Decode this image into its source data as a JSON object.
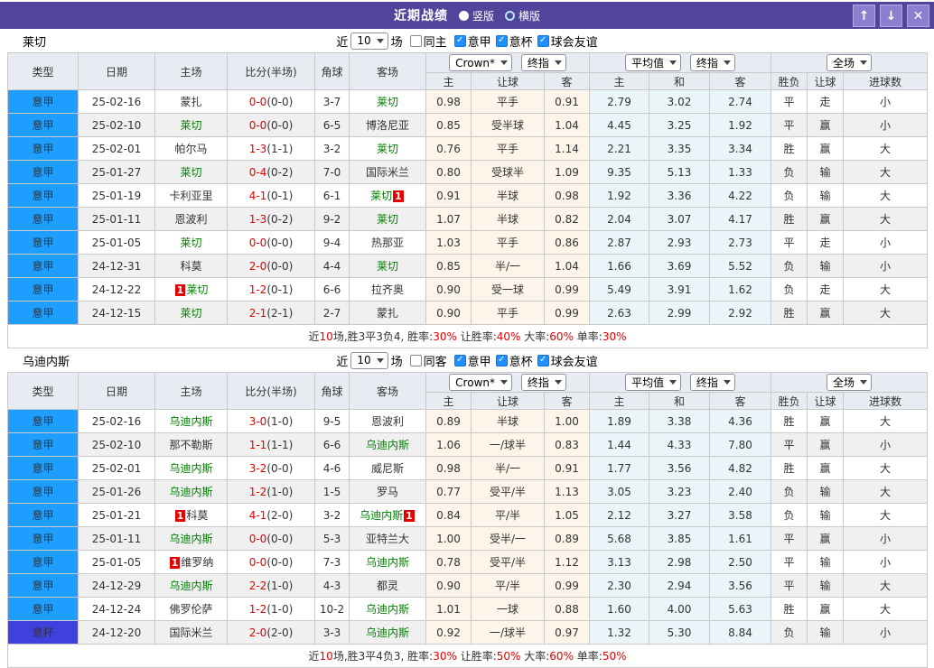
{
  "titlebar": {
    "title": "近期战绩",
    "radios": [
      {
        "label": "竖版",
        "selected": true
      },
      {
        "label": "横版",
        "selected": false
      }
    ],
    "buttons": {
      "up": "↑",
      "down": "↓",
      "close": "✕"
    }
  },
  "icons": {
    "check_mark": "✓"
  },
  "accent_colors": {
    "titlebar": "#50459b",
    "league_serie_a": "#1e9fff",
    "league_cup": "#4040dd",
    "win_red": "#e60000",
    "draw_green": "#008000",
    "lose_blue": "#2b2bd5",
    "odds_column_bg": "#fdf5ea",
    "average_column_bg": "#eaf5fa"
  },
  "filter_shared": {
    "near": "近",
    "games": "场"
  },
  "header": {
    "static_cols": [
      "类型",
      "日期",
      "主场",
      "比分(半场)",
      "角球",
      "客场"
    ],
    "odds_selects": [
      "Crown*",
      "终指"
    ],
    "odds_sub": [
      "主",
      "让球",
      "客"
    ],
    "avg_selects": [
      "平均值",
      "终指"
    ],
    "avg_sub": [
      "主",
      "和",
      "客"
    ],
    "result_select": "全场",
    "result_sub": [
      "胜负",
      "让球",
      "进球数"
    ]
  },
  "sections": [
    {
      "team": "莱切",
      "filter": {
        "count": "10",
        "same_label": "同主",
        "same_checked": false,
        "checks": [
          {
            "label": "意甲",
            "checked": true
          },
          {
            "label": "意杯",
            "checked": true
          },
          {
            "label": "球会友谊",
            "checked": true
          }
        ]
      },
      "rows": [
        {
          "league": "意甲",
          "date": "25-02-16",
          "home": "蒙扎",
          "home_green": false,
          "ft": "0-0",
          "ht": "(0-0)",
          "corner": "3-7",
          "away": "莱切",
          "away_green": true,
          "odds": [
            "0.98",
            "平手",
            "0.91"
          ],
          "avg": [
            "2.79",
            "3.02",
            "2.74"
          ],
          "results": [
            "平",
            "走",
            "小"
          ]
        },
        {
          "league": "意甲",
          "date": "25-02-10",
          "home": "莱切",
          "home_green": true,
          "ft": "0-0",
          "ht": "(0-0)",
          "corner": "6-5",
          "away": "博洛尼亚",
          "away_green": false,
          "odds": [
            "0.85",
            "受半球",
            "1.04"
          ],
          "avg": [
            "4.45",
            "3.25",
            "1.92"
          ],
          "results": [
            "平",
            "赢",
            "小"
          ]
        },
        {
          "league": "意甲",
          "date": "25-02-01",
          "home": "帕尔马",
          "home_green": false,
          "ft": "1-3",
          "ht": "(1-1)",
          "corner": "3-2",
          "away": "莱切",
          "away_green": true,
          "odds": [
            "0.76",
            "平手",
            "1.14"
          ],
          "avg": [
            "2.21",
            "3.35",
            "3.34"
          ],
          "results": [
            "胜",
            "赢",
            "大"
          ]
        },
        {
          "league": "意甲",
          "date": "25-01-27",
          "home": "莱切",
          "home_green": true,
          "ft": "0-4",
          "ht": "(0-2)",
          "corner": "7-0",
          "away": "国际米兰",
          "away_green": false,
          "odds": [
            "0.80",
            "受球半",
            "1.09"
          ],
          "avg": [
            "9.35",
            "5.13",
            "1.33"
          ],
          "results": [
            "负",
            "输",
            "大"
          ]
        },
        {
          "league": "意甲",
          "date": "25-01-19",
          "home": "卡利亚里",
          "home_green": false,
          "ft": "4-1",
          "ht": "(0-1)",
          "corner": "6-1",
          "away": "莱切",
          "away_green": true,
          "away_badge": "1",
          "odds": [
            "0.91",
            "半球",
            "0.98"
          ],
          "avg": [
            "1.92",
            "3.36",
            "4.22"
          ],
          "results": [
            "负",
            "输",
            "大"
          ]
        },
        {
          "league": "意甲",
          "date": "25-01-11",
          "home": "恩波利",
          "home_green": false,
          "ft": "1-3",
          "ht": "(0-2)",
          "corner": "9-2",
          "away": "莱切",
          "away_green": true,
          "odds": [
            "1.07",
            "半球",
            "0.82"
          ],
          "avg": [
            "2.04",
            "3.07",
            "4.17"
          ],
          "results": [
            "胜",
            "赢",
            "大"
          ]
        },
        {
          "league": "意甲",
          "date": "25-01-05",
          "home": "莱切",
          "home_green": true,
          "ft": "0-0",
          "ht": "(0-0)",
          "corner": "9-4",
          "away": "热那亚",
          "away_green": false,
          "odds": [
            "1.03",
            "平手",
            "0.86"
          ],
          "avg": [
            "2.87",
            "2.93",
            "2.73"
          ],
          "results": [
            "平",
            "走",
            "小"
          ]
        },
        {
          "league": "意甲",
          "date": "24-12-31",
          "home": "科莫",
          "home_green": false,
          "ft": "2-0",
          "ht": "(0-0)",
          "corner": "4-4",
          "away": "莱切",
          "away_green": true,
          "odds": [
            "0.85",
            "半/一",
            "1.04"
          ],
          "avg": [
            "1.66",
            "3.69",
            "5.52"
          ],
          "results": [
            "负",
            "输",
            "小"
          ]
        },
        {
          "league": "意甲",
          "date": "24-12-22",
          "home": "莱切",
          "home_green": true,
          "home_badge": "1",
          "ft": "1-2",
          "ht": "(0-1)",
          "corner": "6-6",
          "away": "拉齐奥",
          "away_green": false,
          "odds": [
            "0.90",
            "受一球",
            "0.99"
          ],
          "avg": [
            "5.49",
            "3.91",
            "1.62"
          ],
          "results": [
            "负",
            "走",
            "大"
          ]
        },
        {
          "league": "意甲",
          "date": "24-12-15",
          "home": "莱切",
          "home_green": true,
          "ft": "2-1",
          "ht": "(2-1)",
          "corner": "2-7",
          "away": "蒙扎",
          "away_green": false,
          "odds": [
            "0.90",
            "平手",
            "0.99"
          ],
          "avg": [
            "2.63",
            "2.99",
            "2.92"
          ],
          "results": [
            "胜",
            "赢",
            "大"
          ]
        }
      ],
      "summary_parts": [
        {
          "t": "近"
        },
        {
          "t": "10",
          "red": true
        },
        {
          "t": "场,胜3平3负4, 胜率:"
        },
        {
          "t": "30%",
          "red": true
        },
        {
          "t": " 让胜率:"
        },
        {
          "t": "40%",
          "red": true
        },
        {
          "t": " 大率:"
        },
        {
          "t": "60%",
          "red": true
        },
        {
          "t": " 单率:"
        },
        {
          "t": "30%",
          "red": true
        }
      ]
    },
    {
      "team": "乌迪内斯",
      "filter": {
        "count": "10",
        "same_label": "同客",
        "same_checked": false,
        "checks": [
          {
            "label": "意甲",
            "checked": true
          },
          {
            "label": "意杯",
            "checked": true
          },
          {
            "label": "球会友谊",
            "checked": true
          }
        ]
      },
      "rows": [
        {
          "league": "意甲",
          "date": "25-02-16",
          "home": "乌迪内斯",
          "home_green": true,
          "ft": "3-0",
          "ht": "(1-0)",
          "corner": "9-5",
          "away": "恩波利",
          "away_green": false,
          "odds": [
            "0.89",
            "半球",
            "1.00"
          ],
          "avg": [
            "1.89",
            "3.38",
            "4.36"
          ],
          "results": [
            "胜",
            "赢",
            "大"
          ]
        },
        {
          "league": "意甲",
          "date": "25-02-10",
          "home": "那不勒斯",
          "home_green": false,
          "ft": "1-1",
          "ht": "(1-1)",
          "corner": "6-6",
          "away": "乌迪内斯",
          "away_green": true,
          "odds": [
            "1.06",
            "一/球半",
            "0.83"
          ],
          "avg": [
            "1.44",
            "4.33",
            "7.80"
          ],
          "results": [
            "平",
            "赢",
            "小"
          ]
        },
        {
          "league": "意甲",
          "date": "25-02-01",
          "home": "乌迪内斯",
          "home_green": true,
          "ft": "3-2",
          "ht": "(0-0)",
          "corner": "4-6",
          "away": "威尼斯",
          "away_green": false,
          "odds": [
            "0.98",
            "半/一",
            "0.91"
          ],
          "avg": [
            "1.77",
            "3.56",
            "4.82"
          ],
          "results": [
            "胜",
            "赢",
            "大"
          ]
        },
        {
          "league": "意甲",
          "date": "25-01-26",
          "home": "乌迪内斯",
          "home_green": true,
          "ft": "1-2",
          "ht": "(1-0)",
          "corner": "1-5",
          "away": "罗马",
          "away_green": false,
          "odds": [
            "0.77",
            "受平/半",
            "1.13"
          ],
          "avg": [
            "3.05",
            "3.23",
            "2.40"
          ],
          "results": [
            "负",
            "输",
            "大"
          ]
        },
        {
          "league": "意甲",
          "date": "25-01-21",
          "home": "科莫",
          "home_green": false,
          "home_badge": "1",
          "ft": "4-1",
          "ht": "(2-0)",
          "corner": "3-2",
          "away": "乌迪内斯",
          "away_green": true,
          "away_badge": "1",
          "odds": [
            "0.84",
            "平/半",
            "1.05"
          ],
          "avg": [
            "2.12",
            "3.27",
            "3.58"
          ],
          "results": [
            "负",
            "输",
            "大"
          ]
        },
        {
          "league": "意甲",
          "date": "25-01-11",
          "home": "乌迪内斯",
          "home_green": true,
          "ft": "0-0",
          "ht": "(0-0)",
          "corner": "5-3",
          "away": "亚特兰大",
          "away_green": false,
          "odds": [
            "1.00",
            "受半/一",
            "0.89"
          ],
          "avg": [
            "5.68",
            "3.85",
            "1.61"
          ],
          "results": [
            "平",
            "赢",
            "小"
          ]
        },
        {
          "league": "意甲",
          "date": "25-01-05",
          "home": "维罗纳",
          "home_green": false,
          "home_badge": "1",
          "ft": "0-0",
          "ht": "(0-0)",
          "corner": "7-3",
          "away": "乌迪内斯",
          "away_green": true,
          "odds": [
            "0.78",
            "受平/半",
            "1.12"
          ],
          "avg": [
            "3.13",
            "2.98",
            "2.50"
          ],
          "results": [
            "平",
            "输",
            "小"
          ]
        },
        {
          "league": "意甲",
          "date": "24-12-29",
          "home": "乌迪内斯",
          "home_green": true,
          "ft": "2-2",
          "ht": "(1-0)",
          "corner": "4-3",
          "away": "都灵",
          "away_green": false,
          "odds": [
            "0.90",
            "平/半",
            "0.99"
          ],
          "avg": [
            "2.30",
            "2.94",
            "3.56"
          ],
          "results": [
            "平",
            "输",
            "大"
          ]
        },
        {
          "league": "意甲",
          "date": "24-12-24",
          "home": "佛罗伦萨",
          "home_green": false,
          "ft": "1-2",
          "ht": "(1-0)",
          "corner": "10-2",
          "away": "乌迪内斯",
          "away_green": true,
          "odds": [
            "1.01",
            "一球",
            "0.88"
          ],
          "avg": [
            "1.60",
            "4.00",
            "5.63"
          ],
          "results": [
            "胜",
            "赢",
            "大"
          ]
        },
        {
          "league": "意杯",
          "date": "24-12-20",
          "home": "国际米兰",
          "home_green": false,
          "ft": "2-0",
          "ht": "(2-0)",
          "corner": "3-3",
          "away": "乌迪内斯",
          "away_green": true,
          "odds": [
            "0.92",
            "一/球半",
            "0.97"
          ],
          "avg": [
            "1.32",
            "5.30",
            "8.84"
          ],
          "results": [
            "负",
            "输",
            "小"
          ]
        }
      ],
      "summary_parts": [
        {
          "t": "近"
        },
        {
          "t": "10",
          "red": true
        },
        {
          "t": "场,胜3平4负3, 胜率:"
        },
        {
          "t": "30%",
          "red": true
        },
        {
          "t": " 让胜率:"
        },
        {
          "t": "50%",
          "red": true
        },
        {
          "t": " 大率:"
        },
        {
          "t": "60%",
          "red": true
        },
        {
          "t": " 单率:"
        },
        {
          "t": "50%",
          "red": true
        }
      ]
    }
  ]
}
